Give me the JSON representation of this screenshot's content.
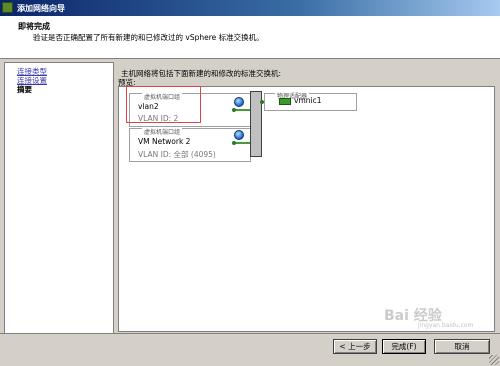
{
  "window": {
    "title": "添加网络向导"
  },
  "header": {
    "title": "即将完成",
    "subtitle": "验证是否正确配置了所有新建的和已修改过的 vSphere 标准交换机。"
  },
  "nav": {
    "items": [
      {
        "label": "连接类型",
        "state": "link"
      },
      {
        "label": "连接设置",
        "state": "link"
      },
      {
        "label": "摘要",
        "state": "current"
      }
    ]
  },
  "main": {
    "description": "主机网络将包括下面新建的和修改的标准交换机:",
    "preview_label": "预览:"
  },
  "diagram": {
    "portgroups": [
      {
        "header": "虚拟机端口组",
        "name": "vlan2",
        "vlan": "VLAN ID: 2"
      },
      {
        "header": "虚拟机端口组",
        "name": "VM Network 2",
        "vlan": "VLAN ID: 全部 (4095)"
      }
    ],
    "adapters": {
      "header": "物理适配器",
      "nic": "vmnic1"
    },
    "colors": {
      "connection": "#4a9a3a",
      "highlight": "#d9464a",
      "nic": "#3a9a2a"
    }
  },
  "buttons": {
    "back": "< 上一步",
    "finish": "完成(F)",
    "cancel": "取消"
  },
  "watermark": {
    "text": "Bai 经验",
    "sub": "jingyan.baidu.com"
  }
}
